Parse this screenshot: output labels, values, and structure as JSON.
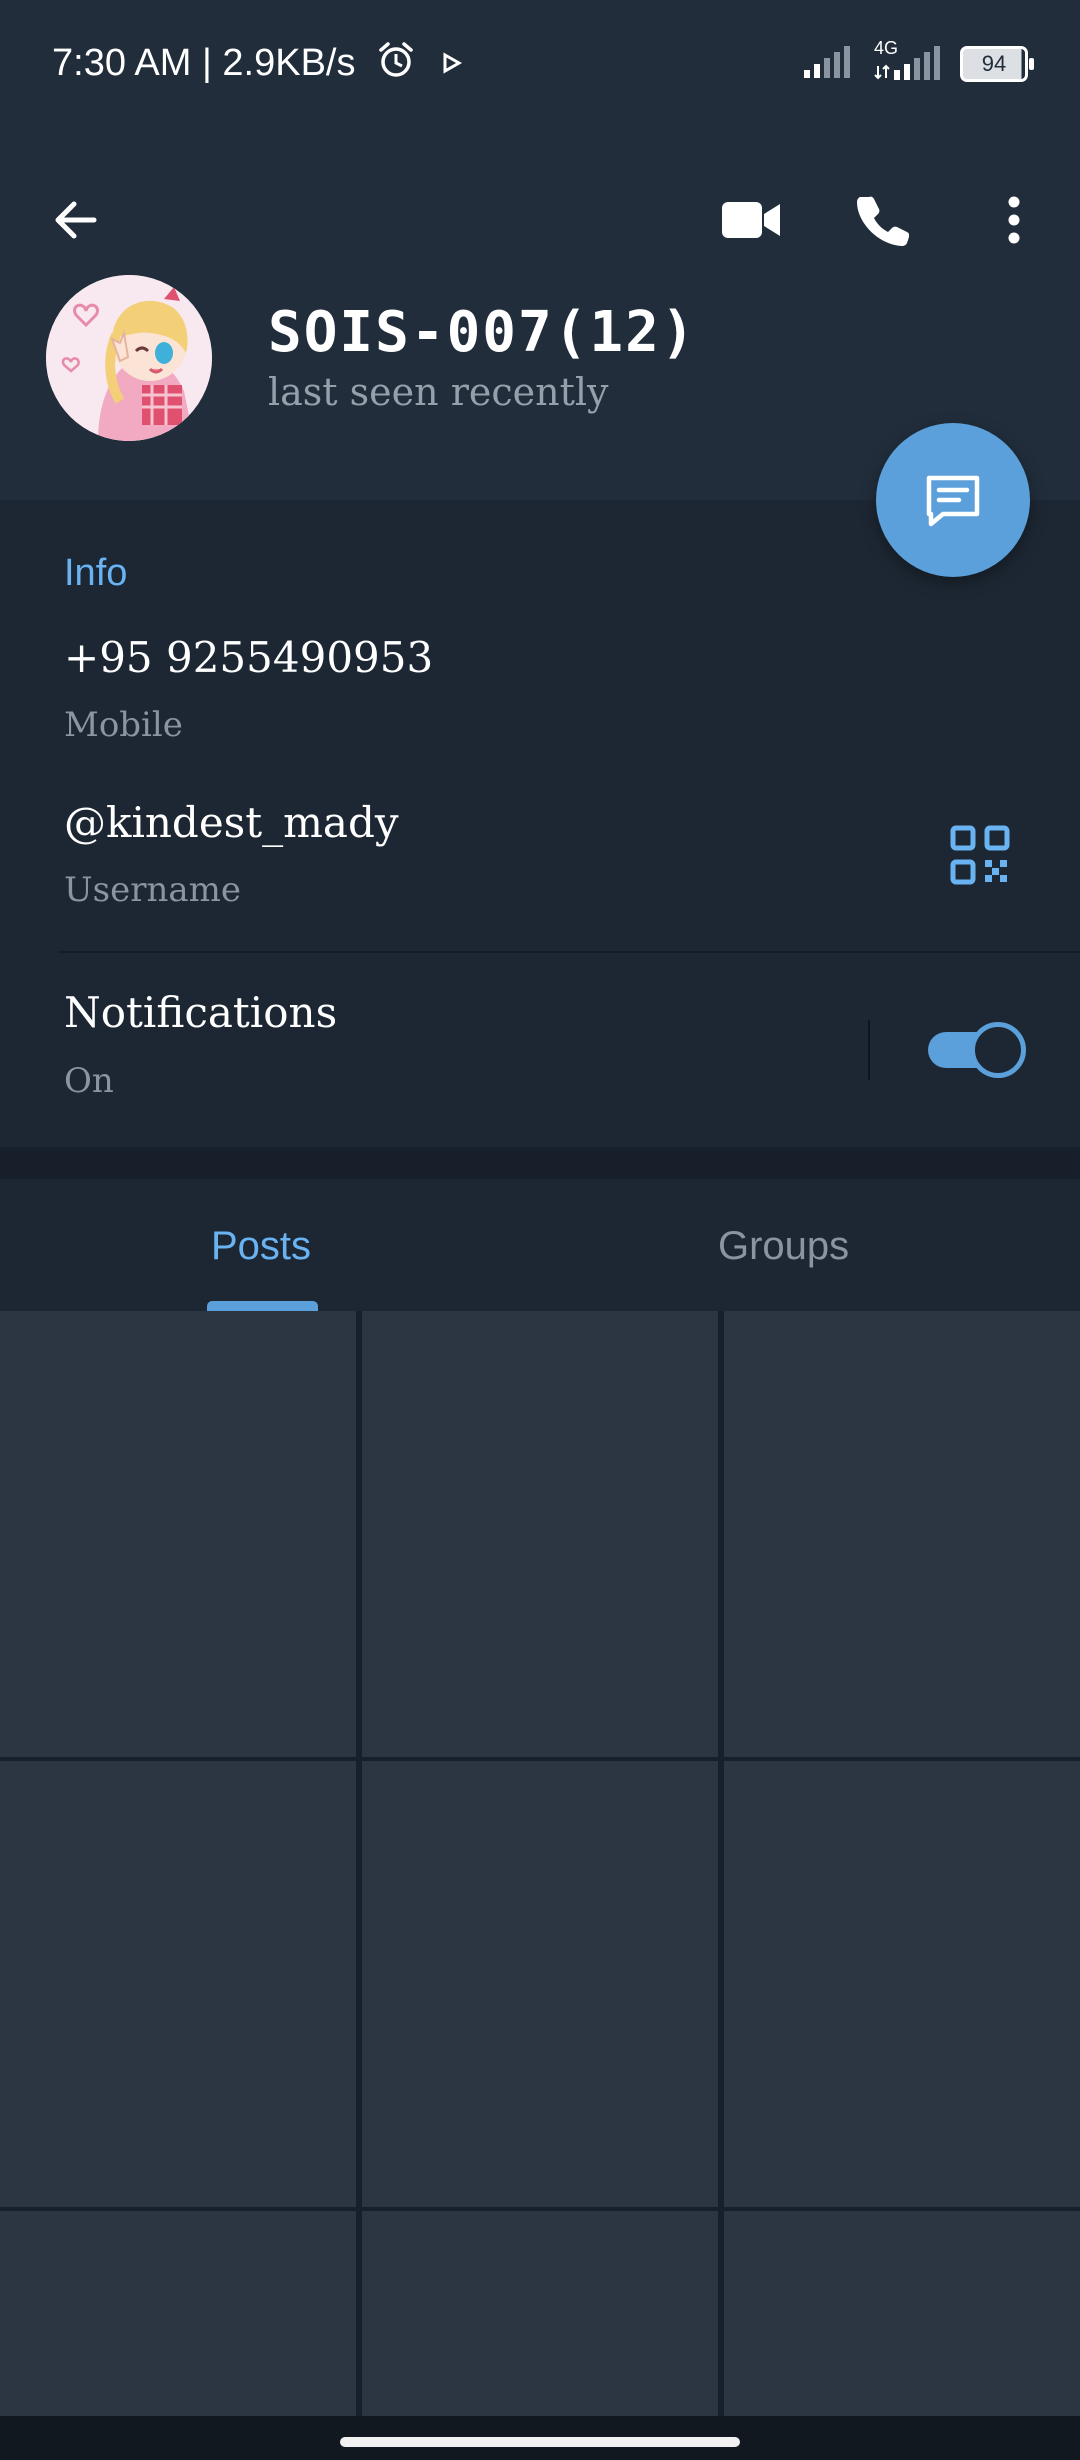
{
  "status_bar": {
    "time_speed": "7:30 AM | 2.9KB/s",
    "network": "4G",
    "battery": "94",
    "icons": [
      "alarm-icon",
      "play-icon",
      "signal-icon",
      "signal-4g-icon"
    ]
  },
  "toolbar": {
    "icons": [
      "back-arrow-icon",
      "video-call-icon",
      "phone-icon",
      "more-vert-icon"
    ]
  },
  "profile": {
    "name": "SOIS-007(12)",
    "status": "last seen recently"
  },
  "info": {
    "section_title": "Info",
    "phone": "+95 9255490953",
    "phone_label": "Mobile",
    "username": "@kindest_mady",
    "username_label": "Username",
    "notifications_title": "Notifications",
    "notifications_state": "On",
    "notifications_enabled": true
  },
  "tabs": [
    {
      "label": "Posts",
      "active": true
    },
    {
      "label": "Groups",
      "active": false
    }
  ],
  "colors": {
    "accent": "#5b9fdb",
    "accent_text": "#6ab3f3",
    "header_bg": "#212d3b",
    "body_bg": "#1d2733"
  }
}
